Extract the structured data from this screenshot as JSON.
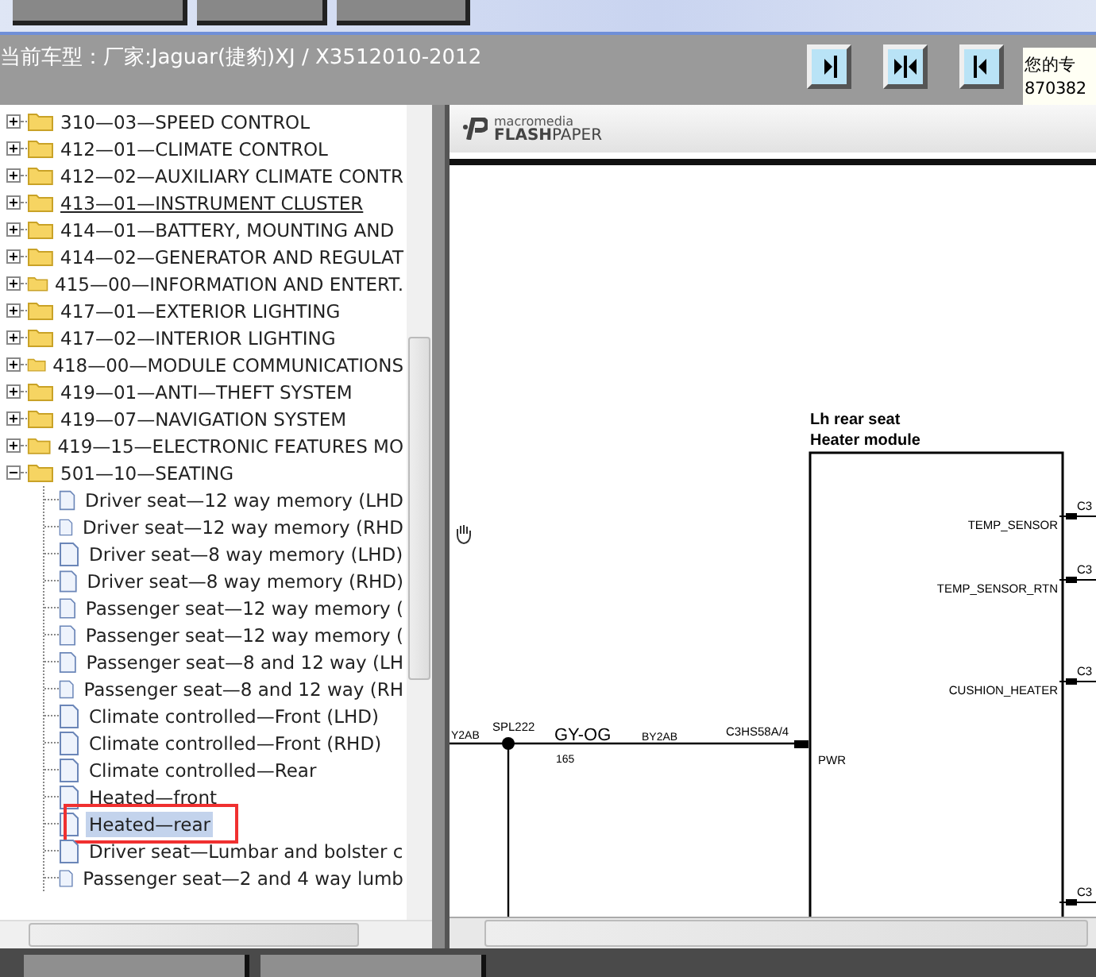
{
  "model_bar": {
    "label": "当前车型：厂家:Jaguar(捷豹)XJ / X3512010-2012"
  },
  "view_buttons": [
    {
      "kind": "right"
    },
    {
      "kind": "both"
    },
    {
      "kind": "left"
    }
  ],
  "notice": {
    "lines": [
      "您的专",
      "870382"
    ]
  },
  "tree": [
    {
      "label": "310—03—SPEED CONTROL",
      "expanded": false,
      "hovered": false
    },
    {
      "label": "412—01—CLIMATE CONTROL",
      "expanded": false,
      "hovered": false
    },
    {
      "label": "412—02—AUXILIARY CLIMATE CONTR",
      "expanded": false,
      "hovered": false
    },
    {
      "label": "413—01—INSTRUMENT CLUSTER",
      "expanded": false,
      "hovered": true
    },
    {
      "label": "414—01—BATTERY, MOUNTING AND",
      "expanded": false,
      "hovered": false
    },
    {
      "label": "414—02—GENERATOR AND REGULAT",
      "expanded": false,
      "hovered": false
    },
    {
      "label": "415—00—INFORMATION AND ENTERT.",
      "expanded": false,
      "hovered": false
    },
    {
      "label": "417—01—EXTERIOR LIGHTING",
      "expanded": false,
      "hovered": false
    },
    {
      "label": "417—02—INTERIOR LIGHTING",
      "expanded": false,
      "hovered": false
    },
    {
      "label": "418—00—MODULE COMMUNICATIONS",
      "expanded": false,
      "hovered": false
    },
    {
      "label": "419—01—ANTI—THEFT SYSTEM",
      "expanded": false,
      "hovered": false
    },
    {
      "label": "419—07—NAVIGATION SYSTEM",
      "expanded": false,
      "hovered": false
    },
    {
      "label": "419—15—ELECTRONIC FEATURES MO",
      "expanded": false,
      "hovered": false
    },
    {
      "label": "501—10—SEATING",
      "expanded": true,
      "hovered": false,
      "children": [
        {
          "label": "Driver seat—12 way memory (LHD",
          "selected": false
        },
        {
          "label": "Driver seat—12 way memory (RHD",
          "selected": false
        },
        {
          "label": "Driver seat—8 way memory (LHD)",
          "selected": false
        },
        {
          "label": "Driver seat—8 way memory (RHD)",
          "selected": false
        },
        {
          "label": "Passenger seat—12 way memory (",
          "selected": false
        },
        {
          "label": "Passenger seat—12 way memory (",
          "selected": false
        },
        {
          "label": "Passenger seat—8 and 12 way (LH",
          "selected": false
        },
        {
          "label": "Passenger seat—8 and 12 way (RH",
          "selected": false
        },
        {
          "label": "Climate controlled—Front (LHD)",
          "selected": false
        },
        {
          "label": "Climate controlled—Front (RHD)",
          "selected": false
        },
        {
          "label": "Climate controlled—Rear",
          "selected": false
        },
        {
          "label": "Heated—front",
          "selected": false
        },
        {
          "label": "Heated—rear",
          "selected": true,
          "annotated": true
        },
        {
          "label": "Driver seat—Lumbar and bolster c",
          "selected": false
        },
        {
          "label": "Passenger seat—2 and 4 way lumb",
          "selected": false
        }
      ]
    }
  ],
  "viewer": {
    "brand_top": "macromedia",
    "brand_bold": "FLASH",
    "brand_rest": "PAPER",
    "schematic": {
      "title_lines": [
        "Lh rear seat",
        "Heater module"
      ],
      "pins": [
        {
          "label": "TEMP_SENSOR",
          "connector": "C3"
        },
        {
          "label": "TEMP_SENSOR_RTN",
          "connector": "C3"
        },
        {
          "label": "CUSHION_HEATER",
          "connector": "C3"
        },
        {
          "connector": "C3"
        }
      ],
      "wire": {
        "left_label": "Y2AB",
        "splice": "SPL222",
        "color_code": "GY-OG",
        "circuit": "165",
        "wire_id": "BY2AB",
        "connector": "C3HS58A/4",
        "pin": "PWR"
      }
    }
  }
}
